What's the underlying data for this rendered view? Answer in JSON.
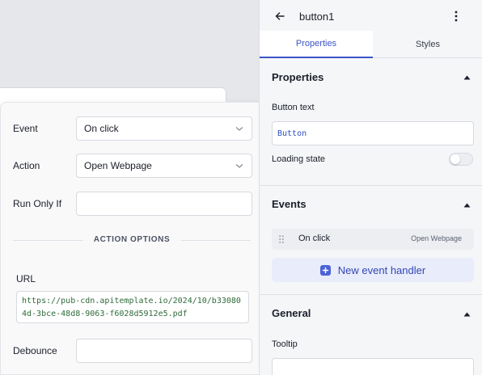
{
  "popover": {
    "event": {
      "label": "Event",
      "value": "On click"
    },
    "action": {
      "label": "Action",
      "value": "Open Webpage"
    },
    "run_only_if": {
      "label": "Run Only If",
      "value": ""
    },
    "options_title": "ACTION OPTIONS",
    "url": {
      "label": "URL",
      "value": "https://pub-cdn.apitemplate.io/2024/10/b330804d-3bce-48d8-9063-f6028d5912e5.pdf"
    },
    "debounce": {
      "label": "Debounce",
      "value": ""
    }
  },
  "panel": {
    "widget_name": "button1",
    "tabs": [
      "Properties",
      "Styles"
    ],
    "properties": {
      "title": "Properties",
      "button_text_label": "Button text",
      "button_text_value": "Button",
      "loading_state_label": "Loading state",
      "loading_state": false
    },
    "events": {
      "title": "Events",
      "items": [
        {
          "event": "On click",
          "action": "Open Webpage"
        }
      ],
      "new_handler_label": "New event handler"
    },
    "general": {
      "title": "General",
      "tooltip_label": "Tooltip",
      "tooltip_value": ""
    }
  },
  "colors": {
    "accent": "#3b55c7",
    "plus_icon": "#4a63d6",
    "new_handler_bg": "#e8ecfb"
  },
  "icons": [
    "back-arrow-icon",
    "kebab-menu-icon",
    "chevron-down-icon",
    "caret-up-icon",
    "drag-grip-icon",
    "plus-icon"
  ]
}
